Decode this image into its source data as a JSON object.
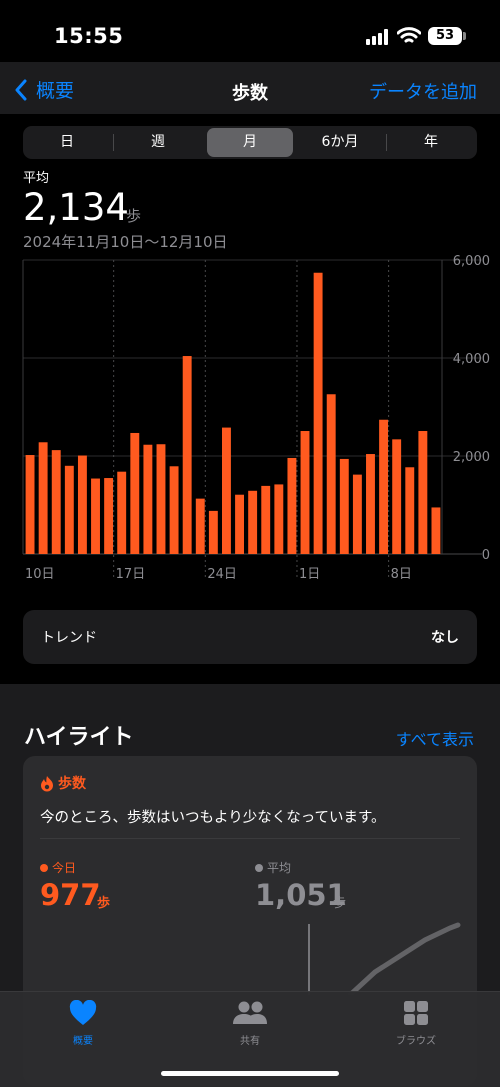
{
  "status_bar": {
    "time": "15:55",
    "battery": "53"
  },
  "nav": {
    "back_label": "概要",
    "title": "歩数",
    "add_label": "データを追加"
  },
  "segments": [
    "日",
    "週",
    "月",
    "6か月",
    "年"
  ],
  "stats": {
    "avg_label": "平均",
    "avg_value": "2,134",
    "avg_unit": "歩",
    "date_range": "2024年11月10日〜12月10日"
  },
  "chart_data": {
    "type": "bar",
    "categories": [
      "11/10",
      "11/11",
      "11/12",
      "11/13",
      "11/14",
      "11/15",
      "11/16",
      "11/17",
      "11/18",
      "11/19",
      "11/20",
      "11/21",
      "11/22",
      "11/23",
      "11/24",
      "11/25",
      "11/26",
      "11/27",
      "11/28",
      "11/29",
      "11/30",
      "12/1",
      "12/2",
      "12/3",
      "12/4",
      "12/5",
      "12/6",
      "12/7",
      "12/8",
      "12/9",
      "12/10"
    ],
    "values": [
      2020,
      2280,
      2120,
      1800,
      2010,
      1540,
      1550,
      1680,
      2470,
      2230,
      2240,
      1790,
      4040,
      1130,
      880,
      2580,
      1210,
      1290,
      1390,
      1420,
      1960,
      2510,
      5740,
      3260,
      1940,
      1620,
      2040,
      2740,
      2340,
      1770,
      2510,
      950
    ],
    "x_tick_labels": [
      "10日",
      "17日",
      "24日",
      "1日",
      "8日"
    ],
    "y_tick_labels": [
      "6,000",
      "4,000",
      "2,000",
      "0"
    ],
    "ylim": [
      0,
      6000
    ],
    "bar_color": "#ff5a1f"
  },
  "trend": {
    "label": "トレンド",
    "value": "なし"
  },
  "highlights": {
    "title": "ハイライト",
    "show_all": "すべて表示",
    "category": "歩数",
    "message": "今のところ、歩数はいつもより少なくなっています。",
    "today_label": "今日",
    "today_value": "977",
    "today_unit": "歩",
    "avg_label": "平均",
    "avg_value": "1,051",
    "avg_unit": "歩"
  },
  "tabs": [
    {
      "label": "概要",
      "icon": "heart-icon",
      "active": true
    },
    {
      "label": "共有",
      "icon": "people-icon",
      "active": false
    },
    {
      "label": "ブラウズ",
      "icon": "grid-icon",
      "active": false
    }
  ],
  "colors": {
    "accent": "#0a84ff",
    "steps": "#ff5a1f",
    "muted": "#8e8e93"
  }
}
